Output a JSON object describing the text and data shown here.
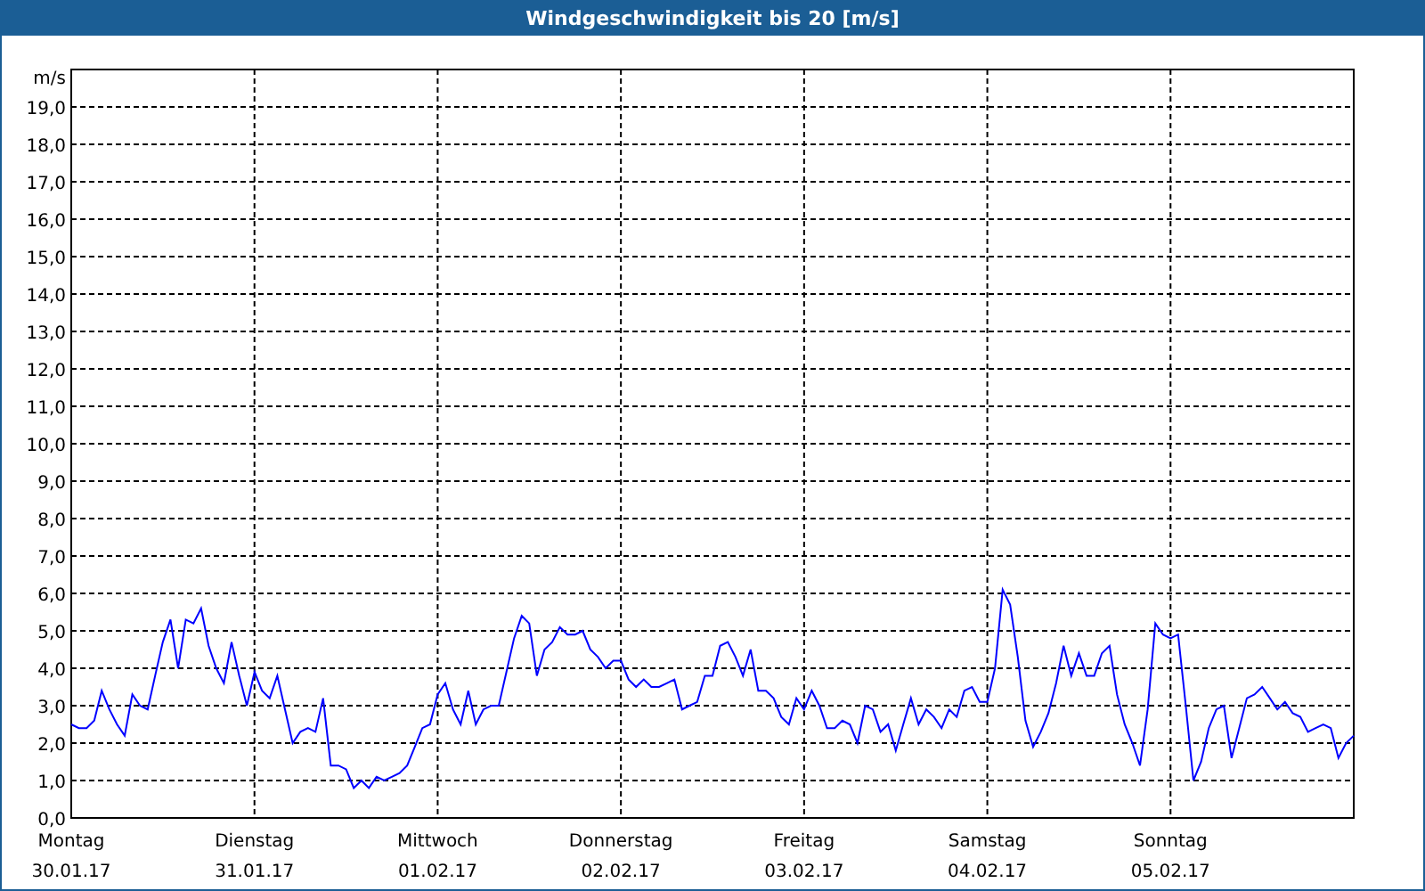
{
  "window": {
    "title": "Windgeschwindigkeit bis 20 [m/s]"
  },
  "chart": {
    "chart_data": {
      "type": "line",
      "ylabel": "m/s",
      "grid": true,
      "ylim": [
        0,
        20
      ],
      "yticks": [
        {
          "value": 0,
          "label": "0,0"
        },
        {
          "value": 1,
          "label": "1,0"
        },
        {
          "value": 2,
          "label": "2,0"
        },
        {
          "value": 3,
          "label": "3,0"
        },
        {
          "value": 4,
          "label": "4,0"
        },
        {
          "value": 5,
          "label": "5,0"
        },
        {
          "value": 6,
          "label": "6,0"
        },
        {
          "value": 7,
          "label": "7,0"
        },
        {
          "value": 8,
          "label": "8,0"
        },
        {
          "value": 9,
          "label": "9,0"
        },
        {
          "value": 10,
          "label": "10,0"
        },
        {
          "value": 11,
          "label": "11,0"
        },
        {
          "value": 12,
          "label": "12,0"
        },
        {
          "value": 13,
          "label": "13,0"
        },
        {
          "value": 14,
          "label": "14,0"
        },
        {
          "value": 15,
          "label": "15,0"
        },
        {
          "value": 16,
          "label": "16,0"
        },
        {
          "value": 17,
          "label": "17,0"
        },
        {
          "value": 18,
          "label": "18,0"
        },
        {
          "value": 19,
          "label": "19,0"
        }
      ],
      "categories": [
        "Montag\n30.01.17",
        null,
        null,
        null,
        null,
        null,
        null,
        null,
        null,
        null,
        null,
        null,
        null,
        null,
        null,
        null,
        null,
        null,
        null,
        null,
        null,
        null,
        null,
        null,
        "Dienstag\n31.01.17",
        null,
        null,
        null,
        null,
        null,
        null,
        null,
        null,
        null,
        null,
        null,
        null,
        null,
        null,
        null,
        null,
        null,
        null,
        null,
        null,
        null,
        null,
        null,
        "Mittwoch\n01.02.17",
        null,
        null,
        null,
        null,
        null,
        null,
        null,
        null,
        null,
        null,
        null,
        null,
        null,
        null,
        null,
        null,
        null,
        null,
        null,
        null,
        null,
        null,
        null,
        "Donnerstag\n02.02.17",
        null,
        null,
        null,
        null,
        null,
        null,
        null,
        null,
        null,
        null,
        null,
        null,
        null,
        null,
        null,
        null,
        null,
        null,
        null,
        null,
        null,
        null,
        null,
        "Freitag\n03.02.17",
        null,
        null,
        null,
        null,
        null,
        null,
        null,
        null,
        null,
        null,
        null,
        null,
        null,
        null,
        null,
        null,
        null,
        null,
        null,
        null,
        null,
        null,
        null,
        "Samstag\n04.02.17",
        null,
        null,
        null,
        null,
        null,
        null,
        null,
        null,
        null,
        null,
        null,
        null,
        null,
        null,
        null,
        null,
        null,
        null,
        null,
        null,
        null,
        null,
        null,
        "Sonntag\n05.02.17",
        null,
        null,
        null,
        null,
        null,
        null,
        null,
        null,
        null,
        null,
        null,
        null,
        null,
        null,
        null,
        null,
        null,
        null,
        null,
        null,
        null,
        null,
        null,
        null
      ],
      "series": [
        {
          "color": "#0000ff",
          "values": [
            2.5,
            2.4,
            2.4,
            2.6,
            3.4,
            2.9,
            2.5,
            2.2,
            3.3,
            3.0,
            2.9,
            3.8,
            4.7,
            5.3,
            4.0,
            5.3,
            5.2,
            5.6,
            4.6,
            4.0,
            3.6,
            4.7,
            3.8,
            3.0,
            3.9,
            3.4,
            3.2,
            3.8,
            2.9,
            2.0,
            2.3,
            2.4,
            2.3,
            3.2,
            1.4,
            1.4,
            1.3,
            0.8,
            1.0,
            0.8,
            1.1,
            1.0,
            1.1,
            1.2,
            1.4,
            1.9,
            2.4,
            2.5,
            3.3,
            3.6,
            2.9,
            2.5,
            3.4,
            2.5,
            2.9,
            3.0,
            3.0,
            3.9,
            4.8,
            5.4,
            5.2,
            3.8,
            4.5,
            4.7,
            5.1,
            4.9,
            4.9,
            5.0,
            4.5,
            4.3,
            4.0,
            4.2,
            4.2,
            3.7,
            3.5,
            3.7,
            3.5,
            3.5,
            3.6,
            3.7,
            2.9,
            3.0,
            3.1,
            3.8,
            3.8,
            4.6,
            4.7,
            4.3,
            3.8,
            4.5,
            3.4,
            3.4,
            3.2,
            2.7,
            2.5,
            3.2,
            2.9,
            3.4,
            3.0,
            2.4,
            2.4,
            2.6,
            2.5,
            2.0,
            3.0,
            2.9,
            2.3,
            2.5,
            1.8,
            2.5,
            3.2,
            2.5,
            2.9,
            2.7,
            2.4,
            2.9,
            2.7,
            3.4,
            3.5,
            3.1,
            3.1,
            4.0,
            6.1,
            5.7,
            4.3,
            2.6,
            1.9,
            2.3,
            2.8,
            3.6,
            4.6,
            3.8,
            4.4,
            3.8,
            3.8,
            4.4,
            4.6,
            3.3,
            2.5,
            2.0,
            1.4,
            2.9,
            5.2,
            4.9,
            4.8,
            4.9,
            3.0,
            1.0,
            1.5,
            2.4,
            2.9,
            3.0,
            1.6,
            2.4,
            3.2,
            3.3,
            3.5,
            3.2,
            2.9,
            3.1,
            2.8,
            2.7,
            2.3,
            2.4,
            2.5,
            2.4,
            1.6,
            2.0,
            2.2
          ]
        }
      ]
    }
  }
}
